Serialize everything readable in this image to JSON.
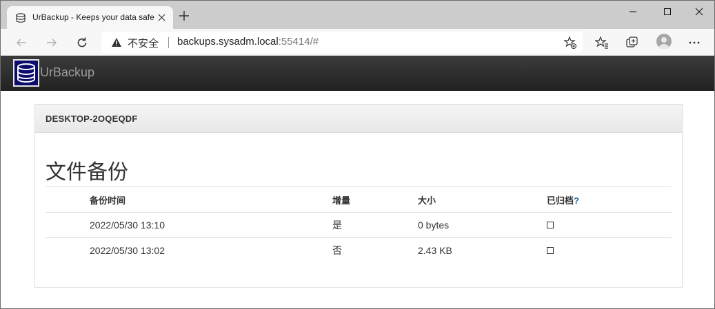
{
  "browser": {
    "tab_title": "UrBackup - Keeps your data safe",
    "insecure_label": "不安全",
    "url_host": "backups.sysadm.local",
    "url_rest": ":55414/#"
  },
  "app": {
    "brand": "UrBackup"
  },
  "client": {
    "name": "DESKTOP-2OQEQDF"
  },
  "file_backups": {
    "title": "文件备份",
    "columns": {
      "time": "备份时间",
      "incremental": "增量",
      "size": "大小",
      "archived": "已归档",
      "archived_help": "?"
    },
    "rows": [
      {
        "time": "2022/05/30 13:10",
        "incremental": "是",
        "size": "0 bytes",
        "archived": false
      },
      {
        "time": "2022/05/30 13:02",
        "incremental": "否",
        "size": "2.43 KB",
        "archived": false
      }
    ]
  }
}
